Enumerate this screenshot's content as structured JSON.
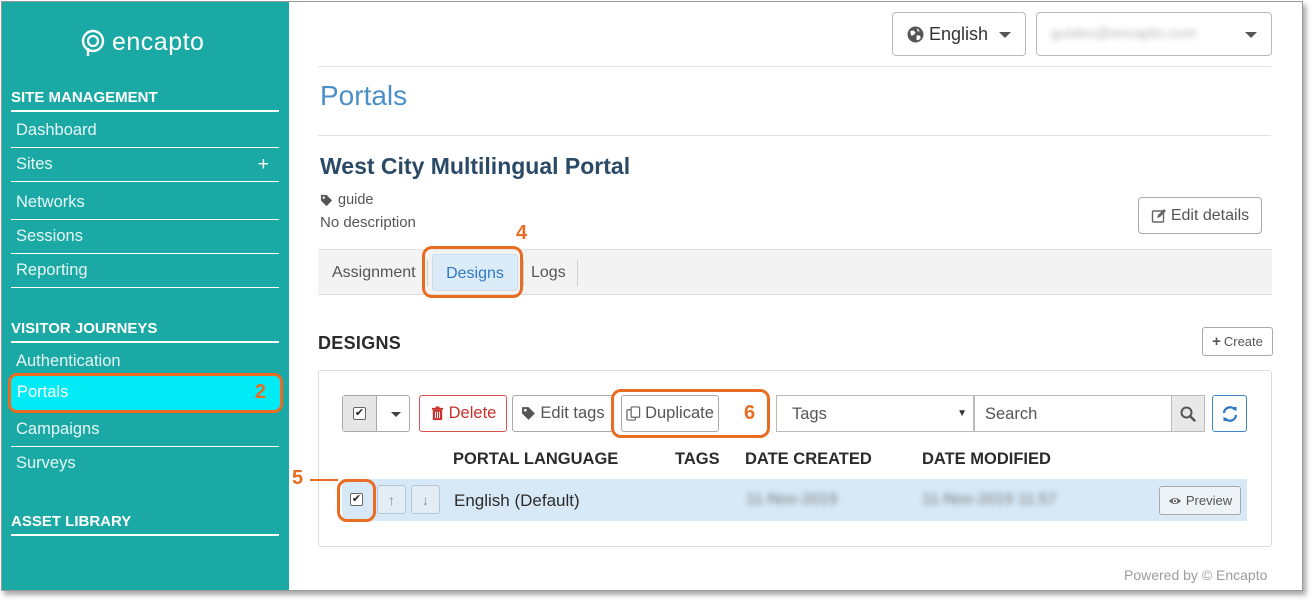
{
  "app": {
    "logo_text": "encapto",
    "colors": {
      "sidebar": "#1ba9a5",
      "active": "#00ebf5",
      "annotation": "#e86d22",
      "link": "#4a8fc7"
    }
  },
  "sidebar": {
    "sections": [
      {
        "title": "SITE MANAGEMENT",
        "items": [
          "Dashboard",
          "Sites",
          "Networks",
          "Sessions",
          "Reporting"
        ]
      },
      {
        "title": "VISITOR JOURNEYS",
        "items": [
          "Authentication",
          "Portals",
          "Campaigns",
          "Surveys"
        ]
      },
      {
        "title": "ASSET LIBRARY",
        "items": []
      }
    ],
    "sites_plus": "+",
    "active_item": "Portals",
    "active_annotation": "2"
  },
  "header": {
    "language": "English",
    "language_icon": "globe-icon",
    "user": "guides@encapto.com"
  },
  "page": {
    "title": "Portals",
    "portal_name": "West City Multilingual Portal",
    "tag": "guide",
    "description": "No description",
    "edit_details": "Edit details"
  },
  "tabs": [
    {
      "label": "Assignment",
      "active": false
    },
    {
      "label": "Designs",
      "active": true
    },
    {
      "label": "Logs",
      "active": false
    }
  ],
  "annotations": {
    "tab": "4",
    "checkbox": "5",
    "duplicate": "6"
  },
  "designs": {
    "heading": "DESIGNS",
    "create": "Create",
    "toolbar": {
      "delete": "Delete",
      "edit_tags": "Edit tags",
      "duplicate": "Duplicate",
      "tags_placeholder": "Tags",
      "search_placeholder": "Search"
    },
    "columns": [
      "PORTAL LANGUAGE",
      "TAGS",
      "DATE CREATED",
      "DATE MODIFIED"
    ],
    "rows": [
      {
        "checked": true,
        "language": "English (Default)",
        "tags": "",
        "date_created": "11-Nov-2019",
        "date_modified": "11-Nov-2019 11:57",
        "preview": "Preview"
      }
    ]
  },
  "footer": {
    "text": "Powered by © Encapto"
  }
}
